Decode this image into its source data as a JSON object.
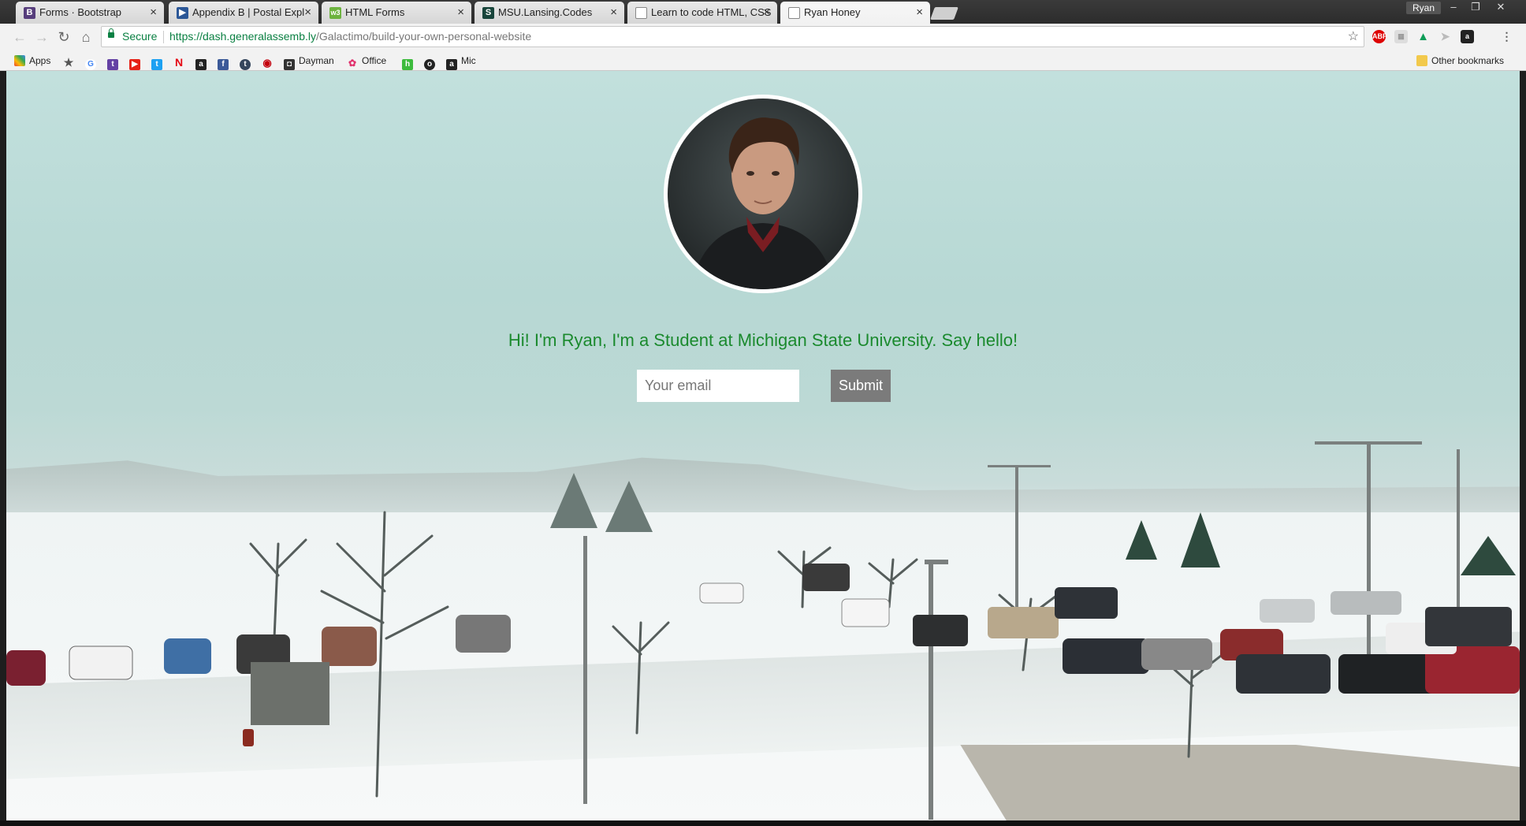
{
  "browser": {
    "tabs": [
      {
        "title": "Forms · Bootstrap",
        "icon": "bootstrap-icon",
        "color": "#563d7c",
        "glyph": "B"
      },
      {
        "title": "Appendix B | Postal Expl",
        "icon": "usps-icon",
        "color": "#2b5797",
        "glyph": "▶"
      },
      {
        "title": "HTML Forms",
        "icon": "w3schools-icon",
        "color": "#6db33f",
        "glyph": "w3"
      },
      {
        "title": "MSU.Lansing.Codes",
        "icon": "msu-icon",
        "color": "#18453b",
        "glyph": "S"
      },
      {
        "title": "Learn to code HTML, CSS",
        "icon": "document-icon",
        "color": "#888888",
        "glyph": ""
      },
      {
        "title": "Ryan Honey",
        "icon": "document-icon",
        "color": "#888888",
        "glyph": ""
      }
    ],
    "user": "Ryan",
    "address": {
      "secure_label": "Secure",
      "url_host": "https://dash.generalassemb.ly",
      "url_path": "/Galactimo/build-your-own-personal-website"
    },
    "bookmarks": [
      {
        "label": "Apps",
        "icon": "apps-icon"
      },
      {
        "label": "",
        "icon": "star-bookmark-icon"
      },
      {
        "label": "",
        "icon": "google-icon"
      },
      {
        "label": "",
        "icon": "twitch-icon"
      },
      {
        "label": "",
        "icon": "youtube-icon"
      },
      {
        "label": "",
        "icon": "twitter-icon"
      },
      {
        "label": "",
        "icon": "netflix-icon"
      },
      {
        "label": "",
        "icon": "amazon-icon"
      },
      {
        "label": "",
        "icon": "facebook-icon"
      },
      {
        "label": "",
        "icon": "tumblr-icon"
      },
      {
        "label": "",
        "icon": "lastfm-icon"
      },
      {
        "label": "Dayman",
        "icon": "dayman-icon"
      },
      {
        "label": "Office",
        "icon": "nbc-icon"
      },
      {
        "label": "",
        "icon": "hulu-icon"
      },
      {
        "label": "",
        "icon": "circle-icon"
      },
      {
        "label": "Mic",
        "icon": "amazon-icon"
      }
    ],
    "other_bookmarks": "Other bookmarks"
  },
  "page": {
    "hero_text": "Hi! I'm Ryan, I'm a Student at Michigan State University. Say hello!",
    "email_placeholder": "Your email",
    "submit_label": "Submit",
    "accent_color": "#1b8a2e"
  }
}
